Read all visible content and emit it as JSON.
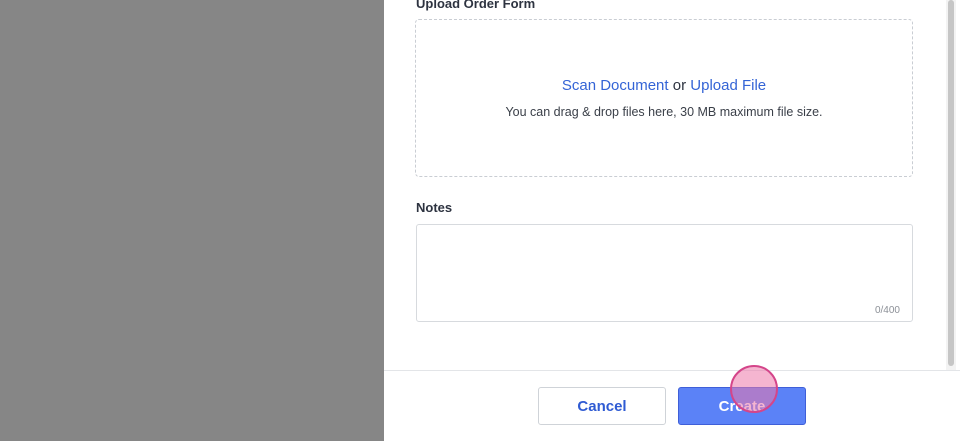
{
  "upload": {
    "label": "Upload Order Form",
    "scan_link": "Scan Document",
    "or_text": "or",
    "upload_link": "Upload File",
    "hint": "You can drag & drop files here, 30 MB maximum file size."
  },
  "notes": {
    "label": "Notes",
    "value": "",
    "counter": "0/400"
  },
  "footer": {
    "cancel_label": "Cancel",
    "create_label": "Create"
  },
  "colors": {
    "overlay": "#868686",
    "link": "#3464d6",
    "primary_button": "#5b82f7",
    "click_marker": "#d4458a"
  }
}
